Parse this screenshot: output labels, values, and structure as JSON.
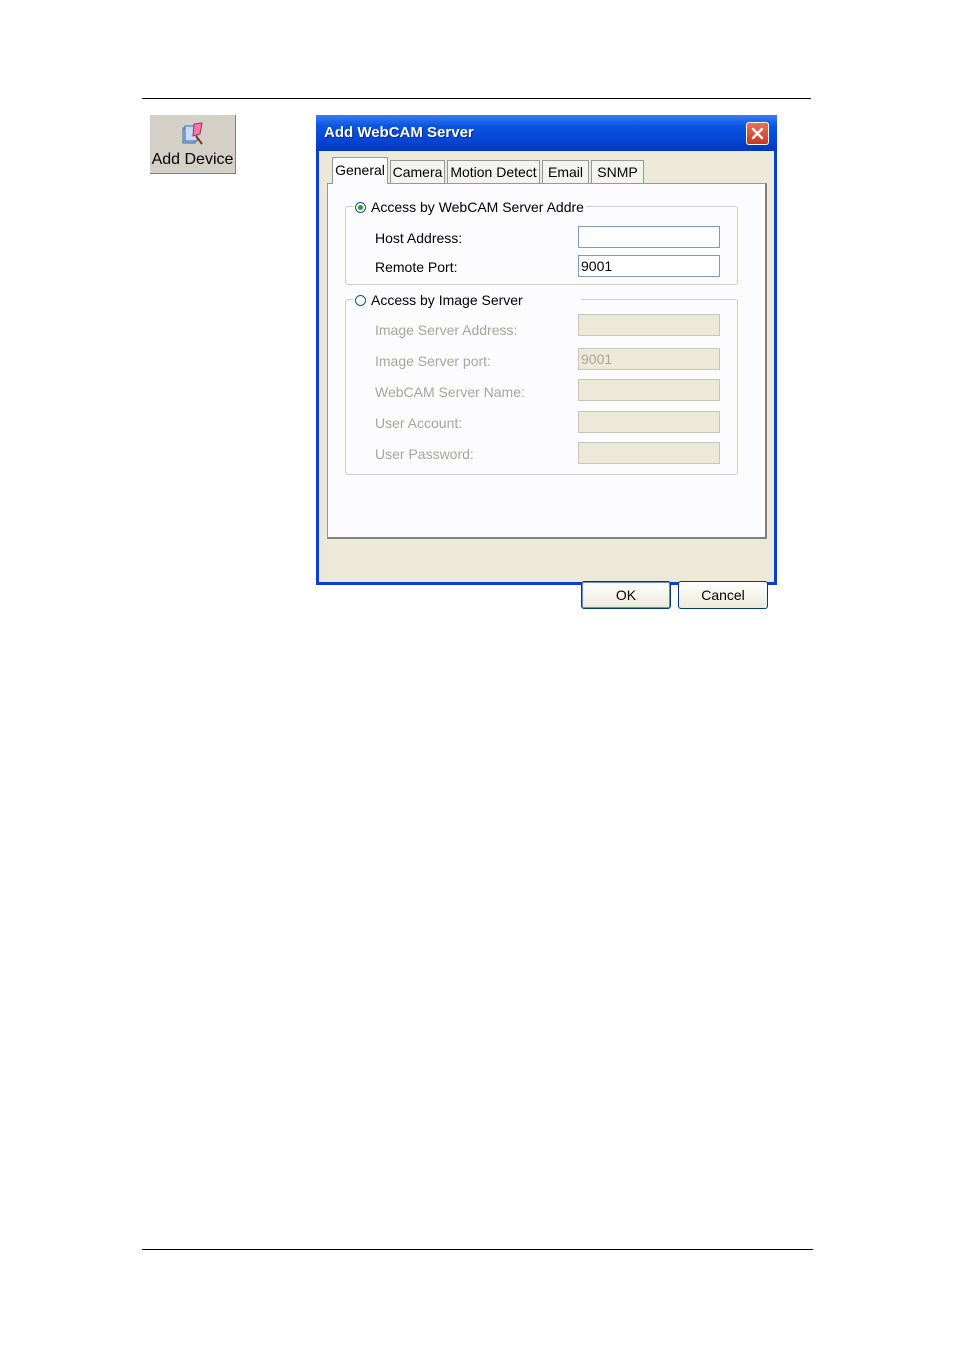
{
  "toolbar": {
    "add_device_label": "Add Device",
    "add_device_icon": "add-device-icon"
  },
  "dialog": {
    "title": "Add WebCAM Server",
    "tabs": [
      {
        "label": "General",
        "active": true
      },
      {
        "label": "Camera",
        "active": false
      },
      {
        "label": "Motion Detect",
        "active": false
      },
      {
        "label": "Email",
        "active": false
      },
      {
        "label": "SNMP",
        "active": false
      }
    ],
    "access_webcam": {
      "label": "Access by WebCAM Server Addre",
      "selected": true,
      "host_address_label": "Host Address:",
      "host_address_value": "",
      "remote_port_label": "Remote Port:",
      "remote_port_value": "9001"
    },
    "access_image": {
      "label": "Access by Image Server",
      "selected": false,
      "image_server_address_label": "Image Server Address:",
      "image_server_address_value": "",
      "image_server_port_label": "Image Server port:",
      "image_server_port_value": "9001",
      "webcam_server_name_label": "WebCAM Server Name:",
      "webcam_server_name_value": "",
      "user_account_label": "User Account:",
      "user_account_value": "",
      "user_password_label": "User Password:",
      "user_password_value": ""
    },
    "ok_label": "OK",
    "cancel_label": "Cancel"
  }
}
